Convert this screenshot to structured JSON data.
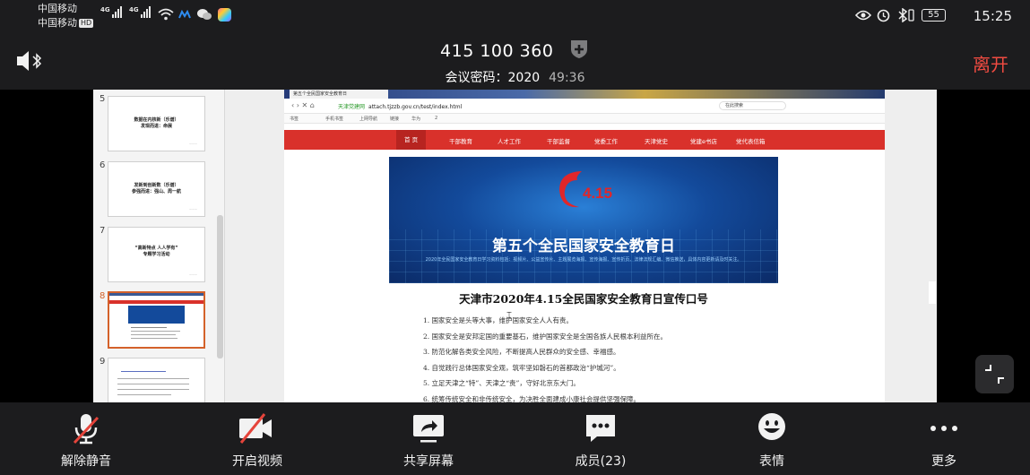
{
  "status_bar": {
    "carrier_1": "中国移动",
    "carrier_2": "中国移动",
    "hd_badge": "HD",
    "net_1": "4G",
    "net_2": "4G",
    "battery": "55",
    "time": "15:25"
  },
  "meeting": {
    "id": "415 100 360",
    "password_label": "会议密码：2020",
    "duration": "49:36",
    "leave_label": "离开"
  },
  "slides_panel": {
    "thumbnails": [
      {
        "num": "5",
        "text": "数据在内核新（乐谱）\n发现而进：命展"
      },
      {
        "num": "6",
        "text": "发新到创新数（乐谱）\n参强而进：强山、周一航"
      },
      {
        "num": "7",
        "text": "“高新特点 人人学有”\n专题学习活动"
      },
      {
        "num": "8",
        "text": ""
      },
      {
        "num": "9",
        "text": ""
      }
    ]
  },
  "browser": {
    "tab_title": "第五个全民国家安全教育日",
    "url_prefix": "天津党建网",
    "url": "attach.tjzzb.gov.cn/test/index.html",
    "search": "在此搜索",
    "bookmarks": [
      "书签",
      "手机书签",
      "上网导航",
      "链接",
      "华为",
      "2"
    ],
    "nav_items": [
      "首 页",
      "干部教育",
      "人才工作",
      "干部监督",
      "党委工作",
      "天津党史",
      "党建e书店",
      "党代表信箱"
    ]
  },
  "banner": {
    "logo_text": "4.15",
    "title": "第五个全民国家安全教育日",
    "subtitle": "2020年全民国家安全教育日学习资料包括：视频片、公益宣传片、主题展览海报、宣传海报、宣传折页、法律法规汇编、微信推送，具体内容更新请及时关注。"
  },
  "document": {
    "title": "天津市2020年4.15全民国家安全教育日宣传口号",
    "items": [
      "1. 国家安全是头等大事，维护国家安全人人有责。",
      "2. 国家安全是安邦定国的重要基石，维护国家安全是全国各族人民根本利益所在。",
      "3. 防范化解各类安全风险，不断提高人民群众的安全感、幸福感。",
      "4. 自觉践行总体国家安全观，筑牢坚如磐石的首都政治“护城河”。",
      "5. 立足天津之“特”、天津之“责”，守好北京东大门。",
      "6. 统筹传统安全和非传统安全，为决胜全面建成小康社会提供坚强保障。"
    ]
  },
  "toolbar": {
    "unmute": "解除静音",
    "video": "开启视频",
    "share": "共享屏幕",
    "members": "成员(23)",
    "reactions": "表情",
    "more": "更多"
  },
  "icons": [
    "speaker-bluetooth-icon",
    "shield-plus-icon",
    "mic-off-icon",
    "video-off-icon",
    "share-screen-icon",
    "members-icon",
    "emoji-icon",
    "more-icon",
    "fullscreen-exit-icon"
  ],
  "colors": {
    "accent_red": "#f04b41",
    "nav_red": "#d9312b",
    "selected_thumb": "#d4622a"
  }
}
